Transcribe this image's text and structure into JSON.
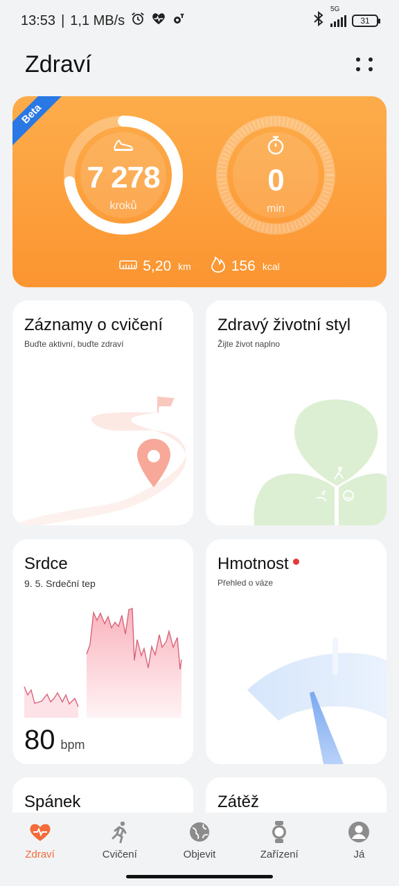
{
  "status": {
    "time": "13:53",
    "net_speed": "1,1 MB/s",
    "network": "5G",
    "battery": "31"
  },
  "header": {
    "title": "Zdraví"
  },
  "activity": {
    "badge": "Beta",
    "steps_value": "7 278",
    "steps_unit": "kroků",
    "steps_progress": 0.73,
    "minutes_value": "0",
    "minutes_unit": "min",
    "distance_value": "5,20",
    "distance_unit": "km",
    "calories_value": "156",
    "calories_unit": "kcal",
    "colors": {
      "card": "#fb9531",
      "ribbon": "#2a78e4"
    }
  },
  "cards": {
    "exercise": {
      "title": "Záznamy o cvičení",
      "subtitle": "Buďte aktivní, buďte zdraví"
    },
    "lifestyle": {
      "title": "Zdravý životní styl",
      "subtitle": "Žijte život naplno"
    },
    "heart": {
      "title": "Srdce",
      "subtitle": "9. 5.  Srdeční tep",
      "value": "80",
      "unit": "bpm"
    },
    "weight": {
      "title": "Hmotnost",
      "subtitle": "Přehled o váze"
    },
    "sleep": {
      "title": "Spánek"
    },
    "stress": {
      "title": "Zátěž"
    }
  },
  "nav": {
    "items": [
      {
        "label": "Zdraví",
        "icon": "heart-rate-icon",
        "active": true
      },
      {
        "label": "Cvičení",
        "icon": "running-icon",
        "active": false
      },
      {
        "label": "Objevit",
        "icon": "globe-icon",
        "active": false
      },
      {
        "label": "Zařízení",
        "icon": "watch-icon",
        "active": false
      },
      {
        "label": "Já",
        "icon": "profile-icon",
        "active": false
      }
    ]
  }
}
